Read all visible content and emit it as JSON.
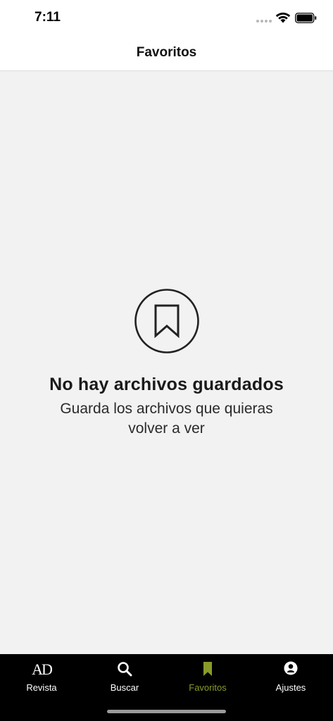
{
  "status_bar": {
    "time": "7:11"
  },
  "header": {
    "title": "Favoritos"
  },
  "empty_state": {
    "icon": "bookmark-icon",
    "title": "No hay archivos guardados",
    "subtitle": "Guarda los archivos que quieras volver a ver"
  },
  "tabs": [
    {
      "label": "Revista",
      "icon": "ad-logo-icon",
      "active": false
    },
    {
      "label": "Buscar",
      "icon": "search-icon",
      "active": false
    },
    {
      "label": "Favoritos",
      "icon": "bookmark-icon",
      "active": true
    },
    {
      "label": "Ajustes",
      "icon": "user-icon",
      "active": false
    }
  ],
  "tab_logo_text": "AD",
  "colors": {
    "accent": "#8a9a2a",
    "tab_bar": "#000000",
    "background": "#f2f2f2"
  }
}
